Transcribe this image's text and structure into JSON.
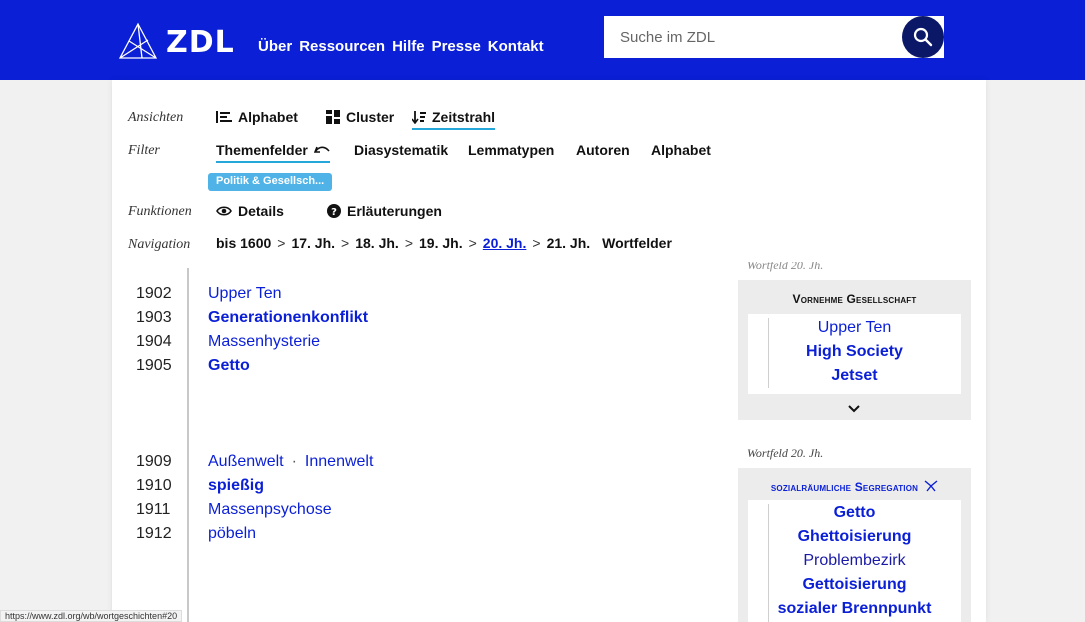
{
  "header": {
    "logo_text": "ZDL",
    "nav": [
      "Über",
      "Ressourcen",
      "Hilfe",
      "Presse",
      "Kontakt"
    ],
    "search_placeholder": "Suche im ZDL",
    "brand_color": "#0a1fd6"
  },
  "controls": {
    "views_label": "Ansichten",
    "views": [
      "Alphabet",
      "Cluster",
      "Zeitstrahl"
    ],
    "filter_label": "Filter",
    "filters": [
      "Themenfelder",
      "Diasystematik",
      "Lemmatypen",
      "Autoren",
      "Alphabet"
    ],
    "active_filter_chip": "Politik & Gesellsch...",
    "functions_label": "Funktionen",
    "functions": [
      "Details",
      "Erläuterungen"
    ],
    "navigation_label": "Navigation",
    "navigation": [
      "bis 1600",
      "17. Jh.",
      "18. Jh.",
      "19. Jh.",
      "20. Jh.",
      "21. Jh.",
      "Wortfelder"
    ],
    "nav_separator": ">"
  },
  "timeline": {
    "group1": [
      {
        "year": "1902",
        "word": "Upper Ten"
      },
      {
        "year": "1903",
        "word": "Generationenkonflikt"
      },
      {
        "year": "1904",
        "word": "Massenhysterie"
      },
      {
        "year": "1905",
        "word": "Getto"
      }
    ],
    "group2": [
      {
        "year": "1909",
        "word": "Außenwelt",
        "word2": "Innenwelt",
        "sep": "·"
      },
      {
        "year": "1910",
        "word": "spießig"
      },
      {
        "year": "1911",
        "word": "Massenpsychose"
      },
      {
        "year": "1912",
        "word": "pöbeln"
      }
    ]
  },
  "wortfelder": {
    "box1": {
      "label": "Wortfeld 20. Jh.",
      "title": "Vornehme Gesellschaft",
      "words": [
        "Upper Ten",
        "High Society",
        "Jetset"
      ]
    },
    "box2": {
      "label": "Wortfeld 20. Jh.",
      "title": "sozialräumliche Segregation",
      "words": [
        "Getto",
        "Ghettoisierung",
        "Problembezirk",
        "Gettoisierung",
        "sozialer Brennpunkt"
      ]
    }
  },
  "status_url": "https://www.zdl.org/wb/wortgeschichten#20"
}
